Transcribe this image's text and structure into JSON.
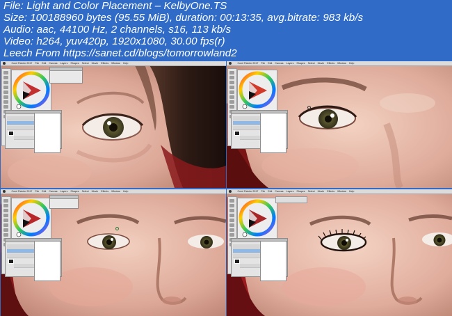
{
  "info": {
    "file_line": "File: Light and Color Placement – KelbyOne.TS",
    "size_line": "Size: 100188960 bytes (95.55 MiB), duration: 00:13:35, avg.bitrate: 983 kb/s",
    "audio_line": "Audio: aac, 44100 Hz, 2 channels, s16, 113 kb/s",
    "video_line": "Video: h264, yuv420p, 1920x1080, 30.00 fps(r)",
    "leech_line": "Leech From https://sanet.cd/blogs/tomorrowland2"
  },
  "colors": {
    "background": "#2f6bc7",
    "info_text": "#ffffff",
    "skin_light": "#f0c8b8",
    "skin_mid": "#d9a292",
    "skin_shadow": "#b8806f",
    "hair_dark": "#3a241c",
    "hair_red": "#8a1a1c",
    "iris": "#6e6a3a",
    "lip": "#c46a6a",
    "panel_bg": "#e9e9e9",
    "selection_blue": "#8fb8e6"
  },
  "icons": {
    "menu_apple": "apple-icon",
    "color_wheel": "color-wheel-icon",
    "brush_cursor": "brush-cursor-icon"
  },
  "thumbnails": [
    {
      "name": "thumbnail-1",
      "timestamp": ""
    },
    {
      "name": "thumbnail-2",
      "timestamp": ""
    },
    {
      "name": "thumbnail-3",
      "timestamp": ""
    },
    {
      "name": "thumbnail-4",
      "timestamp": ""
    }
  ]
}
